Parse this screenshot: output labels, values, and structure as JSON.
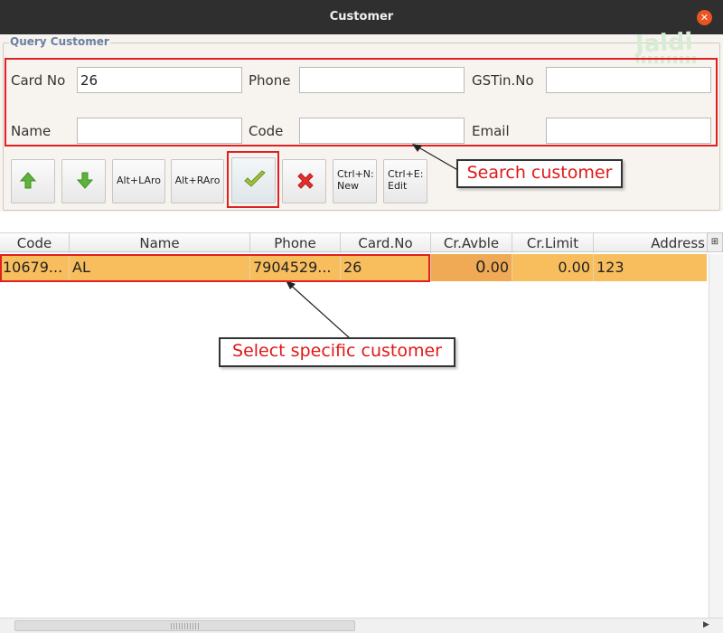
{
  "window": {
    "title": "Customer",
    "close_symbol": "✕"
  },
  "query": {
    "legend": "Query Customer",
    "watermark": "Jaldi",
    "fields": {
      "card_no": {
        "label": "Card No",
        "value": "26"
      },
      "phone": {
        "label": "Phone",
        "value": ""
      },
      "gstin": {
        "label": "GSTin.No",
        "value": ""
      },
      "name": {
        "label": "Name",
        "value": ""
      },
      "code": {
        "label": "Code",
        "value": ""
      },
      "email": {
        "label": "Email",
        "value": ""
      }
    }
  },
  "toolbar": {
    "up_icon": "arrow-up-icon",
    "down_icon": "arrow-down-icon",
    "alt_left": "Alt+LAro",
    "alt_right": "Alt+RAro",
    "ok_icon": "checkmark-icon",
    "cancel_icon": "x-icon",
    "new_line1": "Ctrl+N:",
    "new_line2": "New",
    "edit_line1": "Ctrl+E:",
    "edit_line2": "Edit"
  },
  "annotations": {
    "search": "Search customer",
    "select": "Select specific customer"
  },
  "table": {
    "columns": [
      "Code",
      "Name",
      "Phone",
      "Card.No",
      "Cr.Avble",
      "Cr.Limit",
      "Address"
    ],
    "corner_icon": "column-config-icon",
    "rows": [
      {
        "code": "10679...",
        "name": "AL",
        "phone": "7904529...",
        "card_no": "26",
        "cr_avble_int": "0",
        "cr_avble_dec": ".00",
        "cr_limit": "0.00",
        "address": "123"
      }
    ]
  },
  "colors": {
    "selected_row": "#f8be5e",
    "annotation_red": "#e02020",
    "titlebar": "#2f2f2f",
    "close_button": "#e95420"
  }
}
